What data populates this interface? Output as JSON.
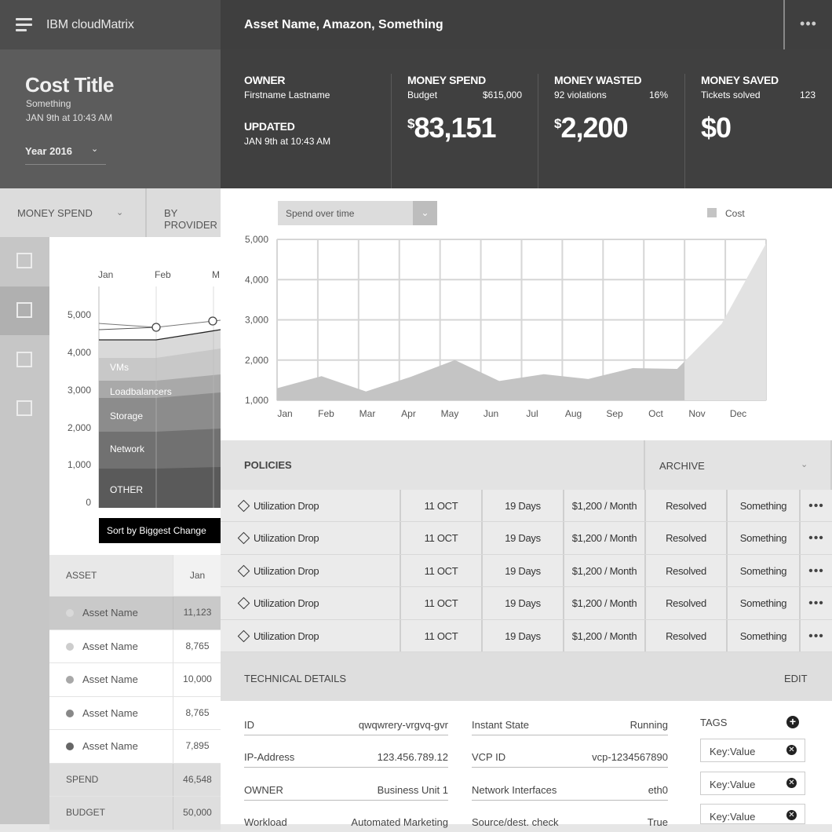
{
  "app": {
    "title": "IBM cloudMatrix"
  },
  "cost": {
    "title": "Cost Title",
    "subtitle": "Something",
    "date": "JAN 9th at 10:43 AM",
    "year": "Year 2016"
  },
  "filters": {
    "money_spend": "MONEY SPEND",
    "by_provider": "BY PROVIDER"
  },
  "left_chart": {
    "months": [
      "Jan",
      "Feb",
      "M"
    ],
    "y_ticks": [
      "5,000",
      "4,000",
      "3,000",
      "2,000",
      "1,000",
      "0"
    ],
    "bands": [
      "VMs",
      "Loadbalancers",
      "Storage",
      "Network",
      "OTHER"
    ],
    "sort_button": "Sort by Biggest Change"
  },
  "asset_table": {
    "headers": [
      "ASSET",
      "Jan"
    ],
    "rows": [
      {
        "name": "Asset Name",
        "value": "11,123",
        "dot": "#d2d2d2"
      },
      {
        "name": "Asset Name",
        "value": "8,765",
        "dot": "#cdcdcd"
      },
      {
        "name": "Asset Name",
        "value": "10,000",
        "dot": "#a8a8a8"
      },
      {
        "name": "Asset Name",
        "value": "8,765",
        "dot": "#888888"
      },
      {
        "name": "Asset Name",
        "value": "7,895",
        "dot": "#666666"
      }
    ],
    "spend": {
      "label": "SPEND",
      "value": "46,548"
    },
    "budget": {
      "label": "BUDGET",
      "value": "50,000"
    }
  },
  "header": {
    "asset_title": "Asset Name, Amazon, Something",
    "more": "•••"
  },
  "summary": {
    "owner_label": "OWNER",
    "owner_value": "Firstname Lastname",
    "updated_label": "UPDATED",
    "updated_value": "JAN 9th at 10:43 AM",
    "spend": {
      "label": "MONEY SPEND",
      "sub_left": "Budget",
      "sub_right": "$615,000",
      "currency": "$",
      "value": "83,151"
    },
    "wasted": {
      "label": "MONEY WASTED",
      "sub_left": "92 violations",
      "sub_right": "16%",
      "currency": "$",
      "value": "2,200"
    },
    "saved": {
      "label": "MONEY SAVED",
      "sub_left": "Tickets solved",
      "sub_right": "123",
      "value": "$0"
    }
  },
  "chart_select": {
    "label": "Spend over time",
    "button": "⌄"
  },
  "chart_data": {
    "type": "area",
    "categories": [
      "Jan",
      "Feb",
      "Mar",
      "Apr",
      "May",
      "Jun",
      "Jul",
      "Aug",
      "Sep",
      "Oct",
      "Nov",
      "Dec"
    ],
    "series": [
      {
        "name": "Cost",
        "values": [
          1300,
          1600,
          1220,
          1580,
          2000,
          1480,
          1650,
          1530,
          1800,
          1780,
          2900,
          4900
        ]
      }
    ],
    "projected_from": "Oct",
    "ylim": [
      1000,
      5000
    ],
    "y_ticks": [
      5000,
      4000,
      3000,
      2000,
      1000
    ],
    "y_tick_labels": [
      "5,000",
      "4,000",
      "3,000",
      "2,000",
      "1,000"
    ],
    "grid": true,
    "legend": "top-right",
    "colors": {
      "actual": "#c4c4c4",
      "projected": "#e2e2e2"
    }
  },
  "policies": {
    "title": "POLICIES",
    "archive": "ARCHIVE",
    "rows": [
      {
        "name": "Utilization Drop",
        "date": "11 OCT",
        "duration": "19 Days",
        "cost": "$1,200 / Month",
        "status": "Resolved",
        "extra": "Something",
        "more": "•••"
      },
      {
        "name": "Utilization Drop",
        "date": "11 OCT",
        "duration": "19 Days",
        "cost": "$1,200 / Month",
        "status": "Resolved",
        "extra": "Something",
        "more": "•••"
      },
      {
        "name": "Utilization Drop",
        "date": "11 OCT",
        "duration": "19 Days",
        "cost": "$1,200 / Month",
        "status": "Resolved",
        "extra": "Something",
        "more": "•••"
      },
      {
        "name": "Utilization Drop",
        "date": "11 OCT",
        "duration": "19 Days",
        "cost": "$1,200 / Month",
        "status": "Resolved",
        "extra": "Something",
        "more": "•••"
      },
      {
        "name": "Utilization Drop",
        "date": "11 OCT",
        "duration": "19 Days",
        "cost": "$1,200 / Month",
        "status": "Resolved",
        "extra": "Something",
        "more": "•••"
      }
    ]
  },
  "tech": {
    "title": "TECHNICAL DETAILS",
    "edit": "EDIT",
    "left": [
      {
        "k": "ID",
        "v": "qwqwrery-vrgvq-gvr"
      },
      {
        "k": "IP-Address",
        "v": "123.456.789.12"
      },
      {
        "k": "OWNER",
        "v": "Business Unit 1"
      },
      {
        "k": "Workload",
        "v": "Automated Marketing"
      }
    ],
    "right": [
      {
        "k": "Instant State",
        "v": "Running"
      },
      {
        "k": "VCP ID",
        "v": "vcp-1234567890"
      },
      {
        "k": "Network Interfaces",
        "v": "eth0"
      },
      {
        "k": "Source/dest. check",
        "v": "True"
      }
    ],
    "tags_label": "TAGS",
    "tags": [
      "Key:Value",
      "Key:Value",
      "Key:Value"
    ]
  }
}
